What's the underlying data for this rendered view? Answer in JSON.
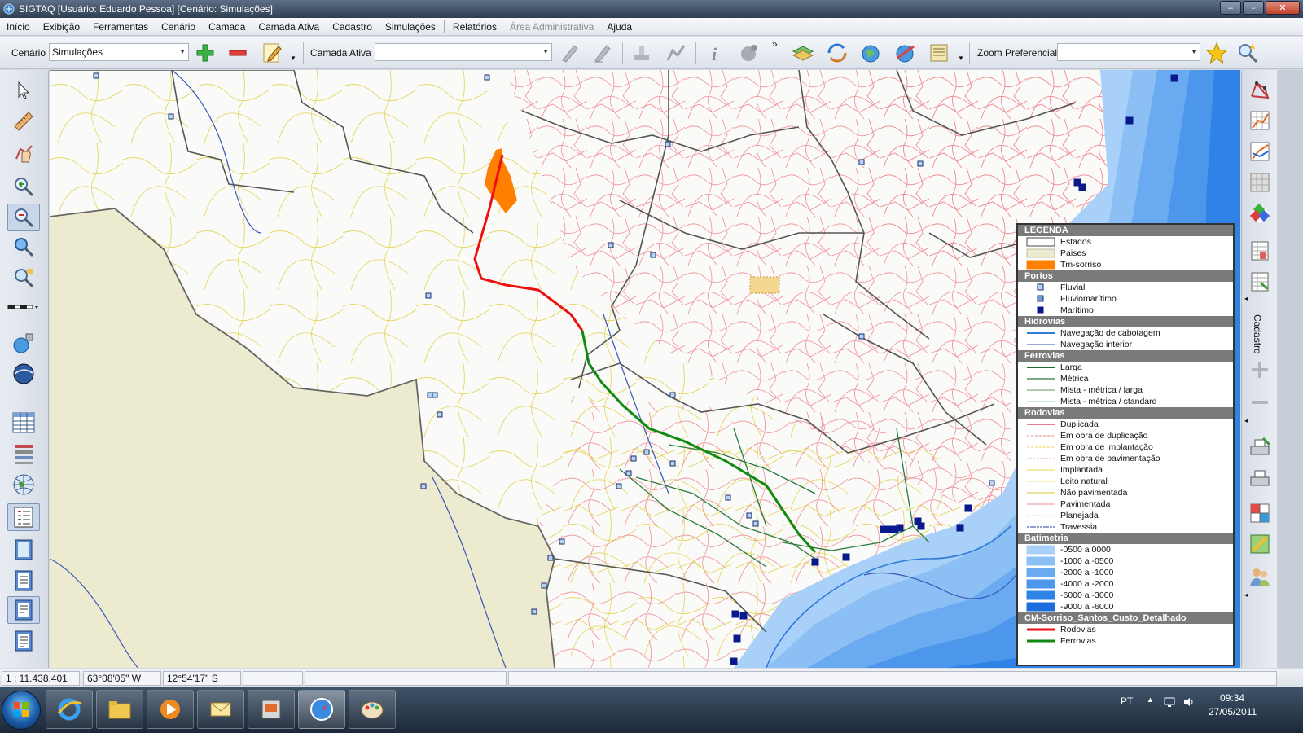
{
  "window": {
    "title": "SIGTAQ [Usuário: Eduardo Pessoa] [Cenário: Simulações]",
    "controls": [
      "–",
      "▫",
      "✕"
    ]
  },
  "menu": [
    {
      "label": "Início",
      "enabled": true
    },
    {
      "label": "Exibição",
      "enabled": true
    },
    {
      "label": "Ferramentas",
      "enabled": true
    },
    {
      "label": "Cenário",
      "enabled": true
    },
    {
      "label": "Camada",
      "enabled": true
    },
    {
      "label": "Camada Ativa",
      "enabled": true
    },
    {
      "label": "Cadastro",
      "enabled": true
    },
    {
      "label": "Simulações",
      "enabled": true
    },
    {
      "label": "Relatórios",
      "enabled": true
    },
    {
      "label": "Área Administrativa",
      "enabled": false
    },
    {
      "label": "Ajuda",
      "enabled": true
    }
  ],
  "toolbar": {
    "cenario_label": "Cenário",
    "cenario_value": "Simulações",
    "camada_ativa_label": "Camada Ativa",
    "camada_ativa_value": "",
    "zoom_label": "Zoom Preferencial",
    "zoom_value": "",
    "overflow": "»"
  },
  "right_panel": {
    "label": "Cadastro"
  },
  "legend": {
    "title": "LEGENDA",
    "sections": [
      {
        "header": null,
        "items": [
          {
            "label": "Estados",
            "symbol": "box",
            "fill": "#ffffff",
            "stroke": "#444444"
          },
          {
            "label": "Paises",
            "symbol": "box",
            "fill": "#eceacf",
            "stroke": "#bdbba0"
          },
          {
            "label": "Tm-sorriso",
            "symbol": "box",
            "fill": "#ff8000",
            "stroke": "#ff8000"
          }
        ]
      },
      {
        "header": "Portos",
        "items": [
          {
            "label": "Fluvial",
            "symbol": "square",
            "fill": "#b7d3f2",
            "stroke": "#1a2b6e"
          },
          {
            "label": "Fluviomarítimo",
            "symbol": "square",
            "fill": "#6e9bd6",
            "stroke": "#1a2b6e"
          },
          {
            "label": "Marítimo",
            "symbol": "square",
            "fill": "#0a1a8c",
            "stroke": "#0a1a8c"
          }
        ]
      },
      {
        "header": "Hidrovias",
        "items": [
          {
            "label": "Navegação de cabotagem",
            "symbol": "line",
            "color": "#2f7bd8",
            "width": 2,
            "dash": ""
          },
          {
            "label": "Navegação interior",
            "symbol": "line",
            "color": "#3a55b8",
            "width": 1,
            "dash": ""
          }
        ]
      },
      {
        "header": "Ferrovias",
        "items": [
          {
            "label": "Larga",
            "symbol": "line",
            "color": "#1a6b2a",
            "width": 2,
            "dash": ""
          },
          {
            "label": "Métrica",
            "symbol": "line",
            "color": "#4f8f5a",
            "width": 1.5,
            "dash": ""
          },
          {
            "label": "Mista - métrica / larga",
            "symbol": "line",
            "color": "#7fb07f",
            "width": 1.2,
            "dash": ""
          },
          {
            "label": "Mista - métrica / standard",
            "symbol": "line",
            "color": "#9fcf9f",
            "width": 1,
            "dash": ""
          }
        ]
      },
      {
        "header": "Rodovias",
        "items": [
          {
            "label": "Duplicada",
            "symbol": "line",
            "color": "#e0526a",
            "width": 1.5,
            "dash": ""
          },
          {
            "label": "Em obra de duplicação",
            "symbol": "line",
            "color": "#e88a8a",
            "width": 1,
            "dash": "3,2"
          },
          {
            "label": "Em obra de implantação",
            "symbol": "line",
            "color": "#e7d44a",
            "width": 1,
            "dash": "3,2"
          },
          {
            "label": "Em obra de pavimentação",
            "symbol": "line",
            "color": "#e89a9a",
            "width": 1,
            "dash": "2,2"
          },
          {
            "label": "Implantada",
            "symbol": "line",
            "color": "#e8d84a",
            "width": 1,
            "dash": ""
          },
          {
            "label": "Leito natural",
            "symbol": "line",
            "color": "#f0e070",
            "width": 1,
            "dash": ""
          },
          {
            "label": "Não pavimentada",
            "symbol": "line",
            "color": "#d8c83a",
            "width": 1,
            "dash": ""
          },
          {
            "label": "Pavimentada",
            "symbol": "line",
            "color": "#ee8a8a",
            "width": 1,
            "dash": ""
          },
          {
            "label": "Planejada",
            "symbol": "line",
            "color": "#f2c0c0",
            "width": 1,
            "dash": "1,2"
          },
          {
            "label": "Travessia",
            "symbol": "line",
            "color": "#2a3a9a",
            "width": 1,
            "dash": "3,1"
          }
        ]
      },
      {
        "header": "Batimetria",
        "items": [
          {
            "label": "-0500 a 0000",
            "symbol": "box",
            "fill": "#a8d0f8",
            "stroke": "#a8d0f8"
          },
          {
            "label": "-1000 a -0500",
            "symbol": "box",
            "fill": "#8cc0f4",
            "stroke": "#8cc0f4"
          },
          {
            "label": "-2000 a -1000",
            "symbol": "box",
            "fill": "#6aaaf0",
            "stroke": "#6aaaf0"
          },
          {
            "label": "-4000 a -2000",
            "symbol": "box",
            "fill": "#4c96ec",
            "stroke": "#4c96ec"
          },
          {
            "label": "-6000 a -3000",
            "symbol": "box",
            "fill": "#2f82e6",
            "stroke": "#2f82e6"
          },
          {
            "label": "-9000 a -6000",
            "symbol": "box",
            "fill": "#1b6edc",
            "stroke": "#1b6edc"
          }
        ]
      },
      {
        "header": "CM-Sorriso_Santos_Custo_Detalhado",
        "items": [
          {
            "label": "Rodovias",
            "symbol": "line",
            "color": "#ee1010",
            "width": 3,
            "dash": ""
          },
          {
            "label": "Ferrovias",
            "symbol": "line",
            "color": "#118a11",
            "width": 3,
            "dash": ""
          }
        ]
      }
    ]
  },
  "status": {
    "scale": "1 : 11.438.401",
    "longitude": "63°08'05\" W",
    "latitude": "12°54'17\" S",
    "empty1": "",
    "empty2": ""
  },
  "taskbar": {
    "apps": [
      "internet-explorer",
      "file-explorer",
      "media-player",
      "outlook",
      "sigtaq",
      "safari",
      "paint"
    ],
    "language": "PT",
    "time": "09:34",
    "date": "27/05/2011"
  },
  "colors": {
    "map_background": "#fafaf8",
    "neighbor_country": "#eceacf",
    "state_border": "#555555",
    "route_road": "#ee1010",
    "route_rail": "#118a11"
  }
}
